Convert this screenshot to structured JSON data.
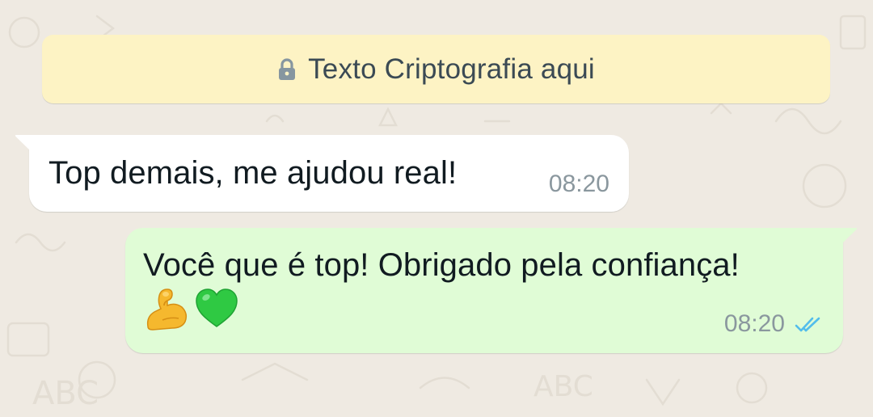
{
  "banner": {
    "icon": "lock-icon",
    "text": "Texto Criptografia aqui"
  },
  "messages": [
    {
      "direction": "incoming",
      "text": "Top demais, me ajudou real!",
      "time": "08:20"
    },
    {
      "direction": "outgoing",
      "text": "Você que é top! Obrigado pela confiança!",
      "emojis": [
        "flexed-biceps-emoji",
        "green-heart-emoji"
      ],
      "time": "08:20",
      "status_icon": "double-check-read-icon"
    }
  ],
  "colors": {
    "wallpaper": "#efeae2",
    "banner_bg": "#fdf3c4",
    "incoming_bubble": "#ffffff",
    "outgoing_bubble": "#e0fcd6",
    "read_ticks": "#53bdeb",
    "timestamp": "#8a979e"
  }
}
